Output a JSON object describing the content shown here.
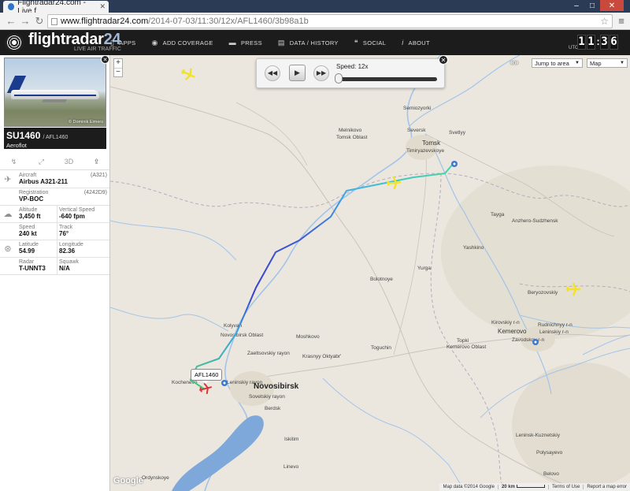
{
  "browser": {
    "tab_title": "Flightradar24.com - Live f",
    "url_host": "www.flightradar24.com",
    "url_path": "/2014-07-03/11:30/12x/AFL1460/3b98a1b"
  },
  "header": {
    "logo_title": "flightradar",
    "logo_num": "24",
    "logo_subtitle": "LIVE AIR TRAFFIC",
    "nav": [
      {
        "label": "APPS",
        "icon": "phone-icon"
      },
      {
        "label": "ADD COVERAGE",
        "icon": "eye-icon"
      },
      {
        "label": "PRESS",
        "icon": "speech-icon"
      },
      {
        "label": "DATA / HISTORY",
        "icon": "database-icon"
      },
      {
        "label": "SOCIAL",
        "icon": "quote-icon"
      },
      {
        "label": "ABOUT",
        "icon": "info-icon"
      }
    ],
    "utc_label": "UTC",
    "clock": {
      "h1": "1",
      "h2": "1",
      "m1": "3",
      "m2": "6",
      "sep": ":"
    }
  },
  "sidebar": {
    "photo_credit": "© Dominik Eimers",
    "callsign": "SU1460",
    "icao_callsign": "/ AFL1460",
    "airline": "Aeroflot",
    "tools": [
      "route-icon",
      "expand-icon",
      "3D",
      "share-icon"
    ],
    "aircraft_label": "Aircraft",
    "aircraft_code": "(A321)",
    "aircraft_value": "Airbus A321-211",
    "registration_label": "Registration",
    "registration_code": "(4242D9)",
    "registration_value": "VP-BOC",
    "altitude_label": "Altitude",
    "altitude_value": "3,450 ft",
    "vspeed_label": "Vertical Speed",
    "vspeed_value": "-640 fpm",
    "speed_label": "Speed",
    "speed_value": "240 kt",
    "track_label": "Track",
    "track_value": "76°",
    "latitude_label": "Latitude",
    "latitude_value": "54.99",
    "longitude_label": "Longitude",
    "longitude_value": "82.36",
    "radar_label": "Radar",
    "radar_value": "T-UNNT3",
    "squawk_label": "Squawk",
    "squawk_value": "N/A"
  },
  "playback": {
    "speed_label": "Speed: 12x",
    "rewind": "◀◀",
    "play": "▶",
    "forward": "▶▶"
  },
  "map_controls": {
    "zoom_in": "+",
    "zoom_out": "−",
    "zoom_arrows": "«»",
    "jump_label": "Jump to area",
    "map_type": "Map"
  },
  "map": {
    "callout": "AFL1460",
    "places": [
      {
        "name": "Semiozyorki",
        "cls": ""
      },
      {
        "name": "Melnikovo",
        "cls": ""
      },
      {
        "name": "Tomsk Oblast",
        "cls": ""
      },
      {
        "name": "Seversk",
        "cls": ""
      },
      {
        "name": "Svetlyy",
        "cls": ""
      },
      {
        "name": "Tomsk",
        "cls": "mid"
      },
      {
        "name": "Timiryazevskoye",
        "cls": ""
      },
      {
        "name": "Tayga",
        "cls": ""
      },
      {
        "name": "Anzhero-Sudzhensk",
        "cls": ""
      },
      {
        "name": "Yashkino",
        "cls": ""
      },
      {
        "name": "Bolotnoye",
        "cls": ""
      },
      {
        "name": "Yurga",
        "cls": ""
      },
      {
        "name": "Beryozovskiy",
        "cls": ""
      },
      {
        "name": "Kolyvan",
        "cls": ""
      },
      {
        "name": "Novosibirsk Oblast",
        "cls": ""
      },
      {
        "name": "Moshkovo",
        "cls": ""
      },
      {
        "name": "Kirovskiy r-n",
        "cls": ""
      },
      {
        "name": "Leninskiy r-n",
        "cls": ""
      },
      {
        "name": "Rudnichnyy r-n",
        "cls": ""
      },
      {
        "name": "Kemerovo",
        "cls": "mid"
      },
      {
        "name": "Zavodskoy r-n",
        "cls": ""
      },
      {
        "name": "Topki",
        "cls": ""
      },
      {
        "name": "Kemerovo Oblast",
        "cls": ""
      },
      {
        "name": "Toguchin",
        "cls": ""
      },
      {
        "name": "Krasnyy Oktyabr'",
        "cls": ""
      },
      {
        "name": "Zaeltsovskiy rayon",
        "cls": ""
      },
      {
        "name": "Kochenevo",
        "cls": ""
      },
      {
        "name": "Leninskiy rayon",
        "cls": ""
      },
      {
        "name": "Novosibirsk",
        "cls": "big"
      },
      {
        "name": "Sovetskiy rayon",
        "cls": ""
      },
      {
        "name": "Berdsk",
        "cls": ""
      },
      {
        "name": "Iskitim",
        "cls": ""
      },
      {
        "name": "Linevo",
        "cls": ""
      },
      {
        "name": "Leninsk-Kuznetskiy",
        "cls": ""
      },
      {
        "name": "Polysayevo",
        "cls": ""
      },
      {
        "name": "Ordynskoye",
        "cls": ""
      },
      {
        "name": "Belovo",
        "cls": ""
      }
    ]
  },
  "attribution": {
    "google": "Google",
    "map_data": "Map data ©2014 Google",
    "scale": "20 km",
    "terms": "Terms of Use",
    "report": "Report a map error"
  },
  "colors": {
    "header_bg": "#1c1c1c",
    "map_land": "#ebe7df",
    "river": "#a3c4e8",
    "water": "#7ea8da",
    "track_low": "#47c776",
    "track_mid": "#39a8e0",
    "track_high": "#3a3fcf",
    "plane_yellow": "#f2e22a",
    "plane_selected": "#e03030"
  }
}
